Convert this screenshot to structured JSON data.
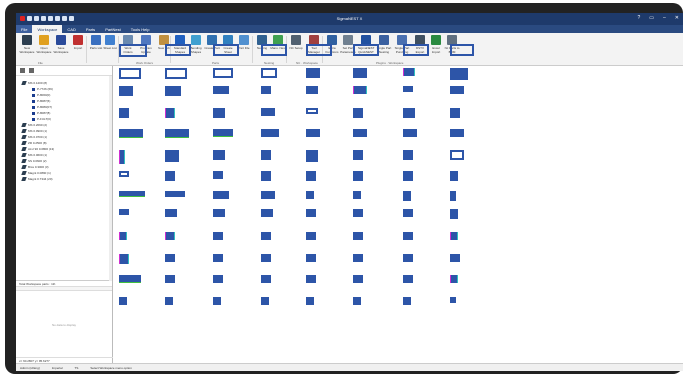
{
  "app": {
    "title": "SigmaNEST X",
    "window_controls": [
      "?",
      "▭",
      "–",
      "✕"
    ]
  },
  "tabs": [
    {
      "label": "File",
      "active": false
    },
    {
      "label": "Workspace",
      "active": true
    },
    {
      "label": "CAD",
      "active": false
    },
    {
      "label": "Parts",
      "active": false
    },
    {
      "label": "PartNest",
      "active": false
    },
    {
      "label": "Tools Help",
      "active": false
    }
  ],
  "ribbon": {
    "buttons": [
      {
        "label": "New Workspace",
        "icon": "new-workspace-icon",
        "color": "#2c3e50"
      },
      {
        "label": "Open Workspace",
        "icon": "open-folder-icon",
        "color": "#e0a020"
      },
      {
        "label": "Save Workspace",
        "icon": "save-icon",
        "color": "#2a4a9a"
      },
      {
        "label": "Import",
        "icon": "import-icon",
        "color": "#c03030"
      },
      {
        "label": "Parts List",
        "icon": "parts-list-icon",
        "color": "#3a70c0"
      },
      {
        "label": "Sheet List",
        "icon": "sheet-list-icon",
        "color": "#4080d0"
      },
      {
        "label": "Work Orders",
        "icon": "work-orders-icon",
        "color": "#6a8ab0"
      },
      {
        "label": "Program Update",
        "icon": "program-update-icon",
        "color": "#5078c0"
      },
      {
        "label": "New Job",
        "icon": "new-job-icon",
        "color": "#c09040"
      },
      {
        "label": "Standard Shapes",
        "icon": "standard-shapes-icon",
        "color": "#2060c0"
      },
      {
        "label": "Bending Shapes",
        "icon": "bending-shapes-icon",
        "color": "#40a0d0"
      },
      {
        "label": "Create Part",
        "icon": "create-part-icon",
        "color": "#3070b0"
      },
      {
        "label": "Create Sheet",
        "icon": "create-sheet-icon",
        "color": "#3080c0"
      },
      {
        "label": "Part File",
        "icon": "part-file-icon",
        "color": "#5090d0"
      },
      {
        "label": "Nesting",
        "icon": "nesting-icon",
        "color": "#306090"
      },
      {
        "label": "Manu. Nest",
        "icon": "manual-nest-icon",
        "color": "#40a050"
      },
      {
        "label": "NC Setup",
        "icon": "nc-setup-icon",
        "color": "#506070"
      },
      {
        "label": "Tool Manager",
        "icon": "tool-manager-icon",
        "color": "#a04040"
      },
      {
        "label": "Extra Functions",
        "icon": "extra-functions-icon",
        "color": "#3060a0"
      },
      {
        "label": "Set Part Parameters",
        "icon": "part-parameters-icon",
        "color": "#708090"
      },
      {
        "label": "SigmaNEST QuickNEST",
        "icon": "quicknest-icon",
        "color": "#2050a0"
      },
      {
        "label": "Single Part Nesting",
        "icon": "single-part-nesting-icon",
        "color": "#3a60a0"
      },
      {
        "label": "Single Part Punching",
        "icon": "single-part-punching-icon",
        "color": "#4a70b0"
      },
      {
        "label": "DSTV Export",
        "icon": "dstv-export-icon",
        "color": "#405060"
      },
      {
        "label": "Excel Import",
        "icon": "excel-import-icon",
        "color": "#2a8a40"
      },
      {
        "label": "Nc Parts to BOM",
        "icon": "nc-parts-bom-icon",
        "color": "#607080"
      }
    ],
    "groups": [
      "File",
      "Work Orders",
      "Parts",
      "Nesting",
      "NC · Workspace",
      "Plugins · Workspace"
    ]
  },
  "tree": {
    "roots": [
      {
        "label": "MS 0.1200 (8)",
        "children": [
          "P-7726 (69)",
          "P-8060(0)",
          "P-8087(6)",
          "P-8080(07)",
          "P-8087(8)",
          "P-FULT(0)"
        ]
      },
      {
        "label": "MS 0.2090 (2)",
        "children": []
      },
      {
        "label": "MS 0.0900 (1)",
        "children": []
      },
      {
        "label": "MS 0.0700 (1)",
        "children": []
      },
      {
        "label": "ZR 0.2500 (8)",
        "children": []
      },
      {
        "label": "ALU 90 0.0800 (13)",
        "children": []
      },
      {
        "label": "MS 0.0600 (1)",
        "children": []
      },
      {
        "label": "SS 0.0600 (2)",
        "children": []
      },
      {
        "label": "Brss 0.3000 (3)",
        "children": []
      },
      {
        "label": "Magnt 0.0890 (1)",
        "children": []
      },
      {
        "label": "Magnt 0.7344 (20)",
        "children": []
      }
    ]
  },
  "left_panel": {
    "total_label": "Total Workspace parts : 1th",
    "preview_text": "No data to display",
    "coords": "x= 60.2807  y= 95.6277"
  },
  "status": {
    "items": [
      "Admin (id:Eng)",
      "Imperial",
      "TS",
      "Select Workspace menu option"
    ]
  }
}
